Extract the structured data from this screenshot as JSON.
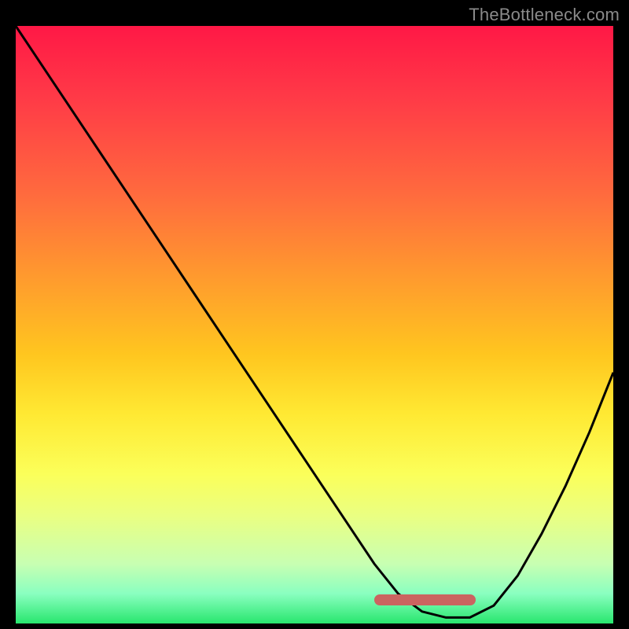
{
  "watermark": "TheBottleneck.com",
  "chart_data": {
    "type": "line",
    "title": "",
    "xlabel": "",
    "ylabel": "",
    "xlim": [
      0,
      100
    ],
    "ylim": [
      0,
      100
    ],
    "grid": false,
    "background": "vertical-gradient red→yellow→green",
    "series": [
      {
        "name": "curve",
        "color": "#000000",
        "x": [
          0,
          6,
          12,
          18,
          24,
          30,
          36,
          42,
          48,
          54,
          60,
          64,
          68,
          72,
          76,
          80,
          84,
          88,
          92,
          96,
          100
        ],
        "y": [
          100,
          91,
          82,
          73,
          64,
          55,
          46,
          37,
          28,
          19,
          10,
          5,
          2,
          1,
          1,
          3,
          8,
          15,
          23,
          32,
          42
        ]
      }
    ],
    "annotations": [
      {
        "name": "optimal-range-marker",
        "color": "#cb6360",
        "x_start": 60,
        "x_end": 77,
        "y": 4
      }
    ]
  }
}
